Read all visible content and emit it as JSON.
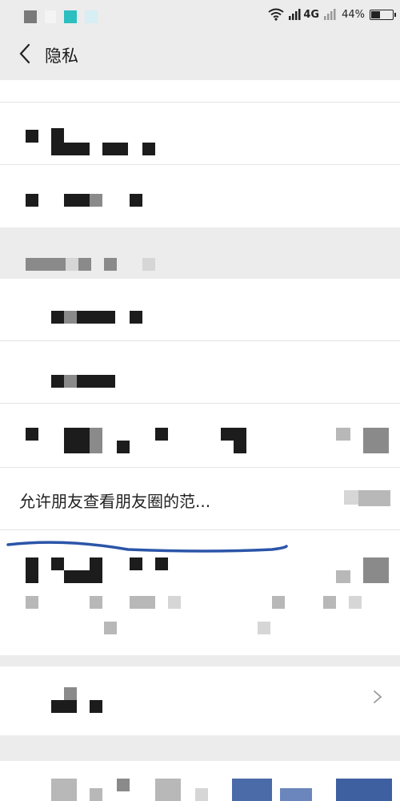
{
  "status_bar": {
    "network": "4G",
    "battery_percent": "44%",
    "battery_level": 0.44
  },
  "header": {
    "title": "隐私"
  },
  "moments_row": {
    "label": "允许朋友查看朋友圈的范..."
  },
  "icons": {
    "back": "chevron-left-icon",
    "wifi": "wifi-icon",
    "signal": "signal-icon",
    "battery": "battery-icon",
    "chevron": "chevron-right-icon"
  },
  "colors": {
    "page_bg": "#ececec",
    "row_bg": "#ffffff",
    "annotation_line": "#2b55a8"
  }
}
